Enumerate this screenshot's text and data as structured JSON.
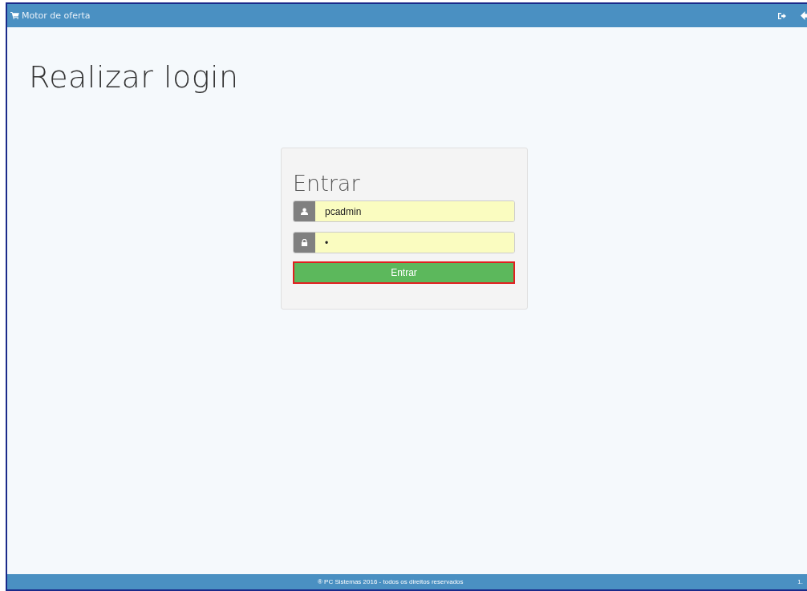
{
  "navbar": {
    "brand": "Motor de oferta"
  },
  "page": {
    "title": "Realizar login"
  },
  "login": {
    "title": "Entrar",
    "username": {
      "value": "pcadmin"
    },
    "password": {
      "value": "•"
    },
    "submit": {
      "label": "Entrar",
      "focused": true
    }
  },
  "footer": {
    "text": "® PC Sistemas 2016 - todos os direitos reservados",
    "version": "1."
  }
}
